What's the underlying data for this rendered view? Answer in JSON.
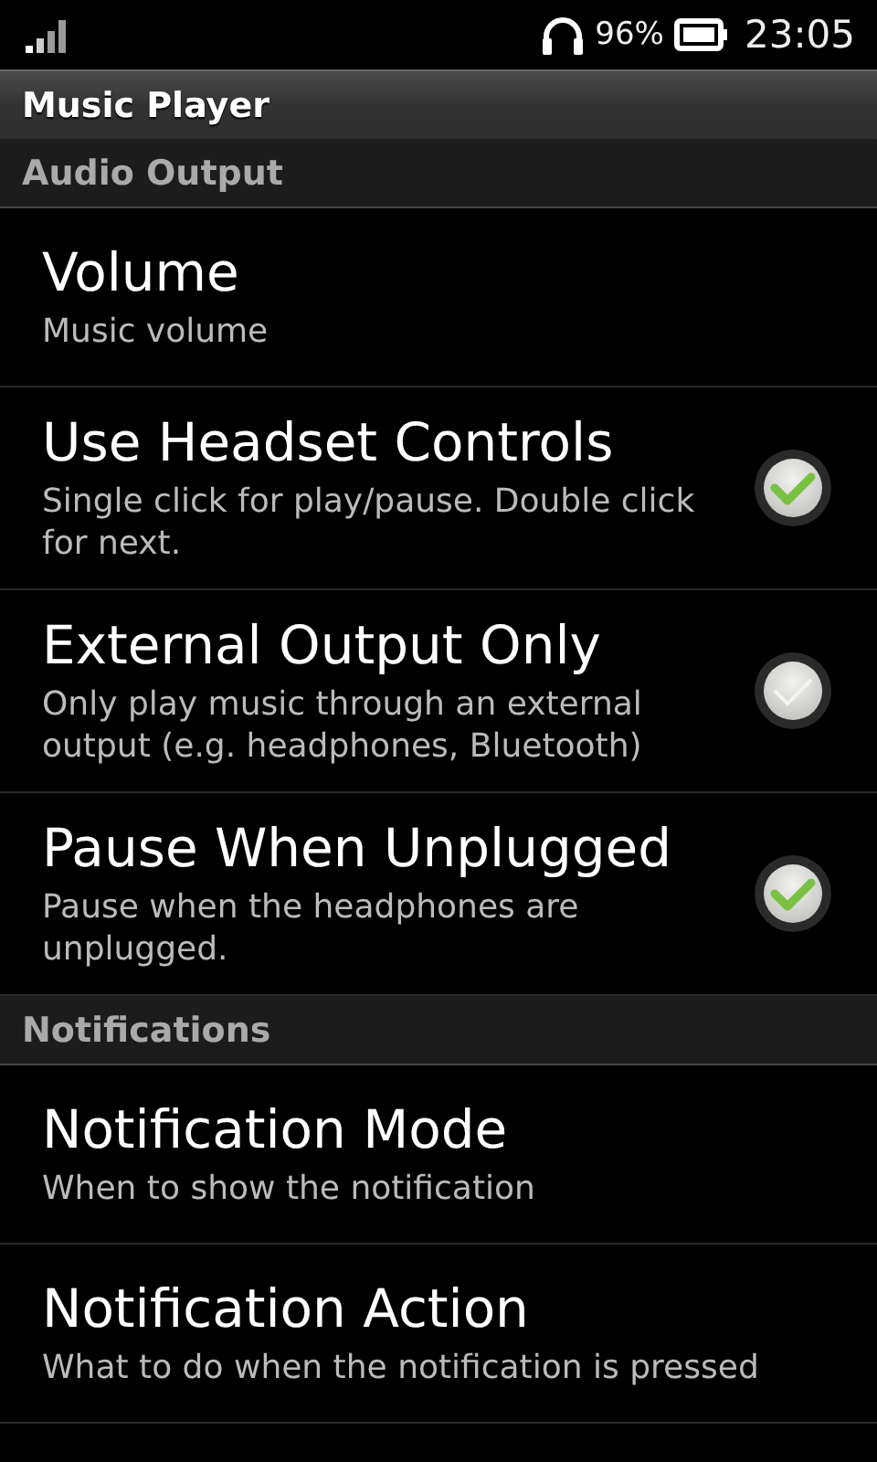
{
  "status_bar": {
    "battery_percent": "96%",
    "time": "23:05"
  },
  "window": {
    "title": "Music Player"
  },
  "sections": [
    {
      "header": "Audio Output",
      "items": [
        {
          "kind": "plain",
          "title": "Volume",
          "summary": "Music volume"
        },
        {
          "kind": "checkbox",
          "title": "Use Headset Controls",
          "summary": "Single click for play/pause. Double click for next.",
          "checked": true
        },
        {
          "kind": "checkbox",
          "title": "External Output Only",
          "summary": "Only play music through an external output (e.g. headphones, Bluetooth)",
          "checked": false
        },
        {
          "kind": "checkbox",
          "title": "Pause When Unplugged",
          "summary": "Pause when the headphones are unplugged.",
          "checked": true
        }
      ]
    },
    {
      "header": "Notifications",
      "items": [
        {
          "kind": "plain",
          "title": "Notification Mode",
          "summary": "When to show the notification"
        },
        {
          "kind": "plain",
          "title": "Notification Action",
          "summary": "What to do when the notification is pressed"
        }
      ]
    }
  ]
}
